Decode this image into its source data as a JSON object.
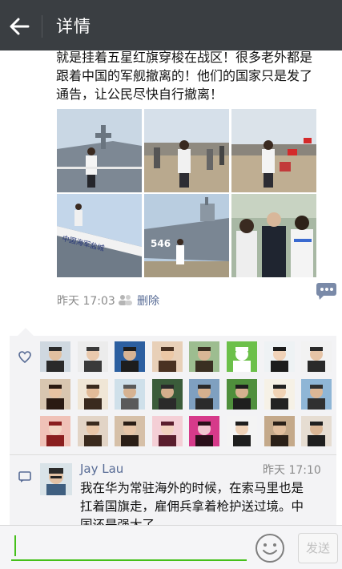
{
  "header": {
    "title": "详情"
  },
  "post": {
    "text_lines": [
      "就是挂着五星红旗穿梭在战区！很多老外都是",
      "跟着中国的军舰撤离的！他们的国家只是发了",
      "通告，让公民尽快自行撤离！"
    ],
    "photos": [
      {
        "label": "man-on-warship-deck"
      },
      {
        "label": "people-on-pier"
      },
      {
        "label": "man-with-flags-on-pier"
      },
      {
        "label": "ship-bow-with-name",
        "text": "中国海军盐城"
      },
      {
        "label": "warship-hull-546",
        "text": "546"
      },
      {
        "label": "group-of-officials"
      }
    ],
    "time": "昨天 17:03",
    "delete_label": "删除"
  },
  "likes": {
    "count": 24
  },
  "comment": {
    "author": "Jay Lau",
    "time": "昨天 17:10",
    "text_lines": [
      "我在华为常驻海外的时候，在索马里也是",
      "扛着国旗走，雇佣兵拿着枪护送过境。中",
      "国还是强大了"
    ]
  },
  "input": {
    "placeholder": "",
    "send_label": "发送"
  },
  "colors": {
    "topbar": "#3a3e42",
    "link": "#576b95",
    "accent": "#45c01a"
  }
}
